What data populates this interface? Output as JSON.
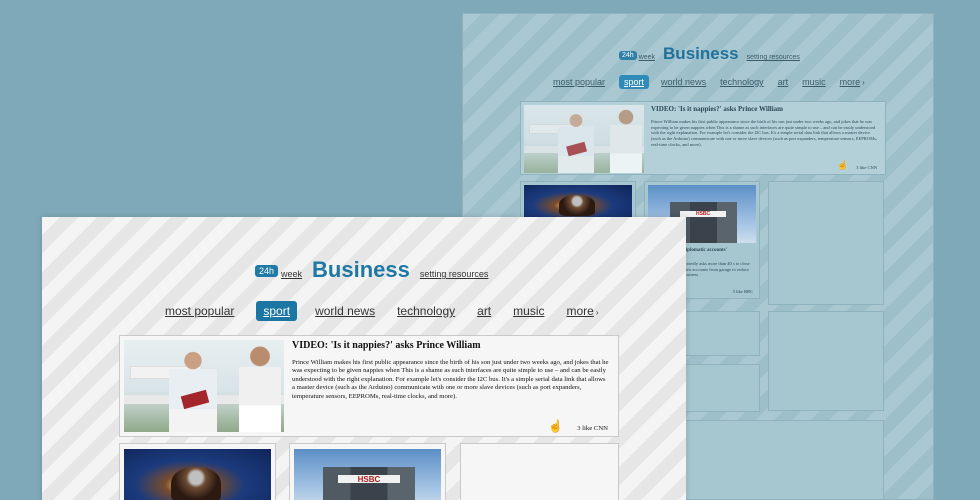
{
  "header": {
    "badge": "24h",
    "week": "week",
    "title": "Business",
    "settings": "setting resources"
  },
  "nav": {
    "items": [
      "most popular",
      "sport",
      "world news",
      "technology",
      "art",
      "music",
      "more"
    ],
    "active": "sport",
    "more_icon": "chevron-right-icon"
  },
  "feature": {
    "headline": "VIDEO: 'Is it nappies?' asks Prince William",
    "summary": "Prince William makes his first public appearance since the birth of his son just under two weeks ago, and jokes that he was expecting to be given nappies when This is a shame as such interfaces are quite simple to use – and can be easily understood with the right explanation. For example let's consider the I2C bus. It's a simple serial data link that allows a master device (such as the Arduino) communicate with one or more slave devices (such as port expanders, temperature sensors, EEPROMs, real-time clocks, and more).",
    "source": "3 like CNN"
  },
  "cards": {
    "hsbc_headline": "diplomatic accounts'",
    "hsbc_summary": "portedly asks more than 40 s to close their accounts from garage to reduce business",
    "hsbc_source": "5 like BBC",
    "hsbc_logo": "HSBC"
  },
  "colors": {
    "accent": "#1f77a3",
    "background": "#7fa9b8"
  }
}
